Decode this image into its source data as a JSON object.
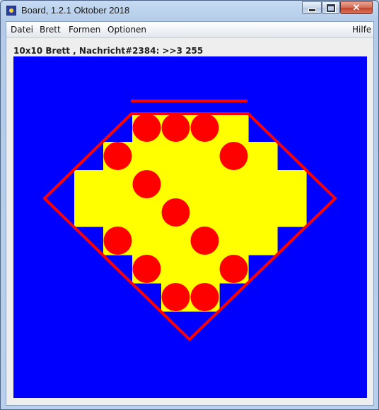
{
  "window": {
    "title": "Board, 1.2.1 Oktober 2018",
    "buttons": {
      "minimize": "minimize-icon",
      "maximize": "maximize-icon",
      "close": "✕"
    }
  },
  "menu": {
    "items": [
      "Datei",
      "Brett",
      "Formen",
      "Optionen"
    ],
    "help": "Hilfe"
  },
  "status": {
    "text": "10x10 Brett , Nachricht#2384: >>3 255"
  },
  "board": {
    "size": 10,
    "colors": {
      "background": "#0000ff",
      "cell": "#ffff00",
      "piece": "#ff0000",
      "outline": "#ff0000"
    },
    "yellow_cells": [
      [
        2,
        0
      ],
      [
        3,
        0
      ],
      [
        4,
        0
      ],
      [
        5,
        0
      ],
      [
        1,
        1
      ],
      [
        2,
        1
      ],
      [
        3,
        1
      ],
      [
        4,
        1
      ],
      [
        5,
        1
      ],
      [
        6,
        1
      ],
      [
        0,
        2
      ],
      [
        1,
        2
      ],
      [
        2,
        2
      ],
      [
        3,
        2
      ],
      [
        4,
        2
      ],
      [
        5,
        2
      ],
      [
        6,
        2
      ],
      [
        7,
        2
      ],
      [
        0,
        3
      ],
      [
        1,
        3
      ],
      [
        2,
        3
      ],
      [
        3,
        3
      ],
      [
        4,
        3
      ],
      [
        5,
        3
      ],
      [
        6,
        3
      ],
      [
        7,
        3
      ],
      [
        1,
        4
      ],
      [
        2,
        4
      ],
      [
        3,
        4
      ],
      [
        4,
        4
      ],
      [
        5,
        4
      ],
      [
        6,
        4
      ],
      [
        2,
        5
      ],
      [
        3,
        5
      ],
      [
        4,
        5
      ],
      [
        5,
        5
      ],
      [
        3,
        6
      ],
      [
        4,
        6
      ]
    ],
    "pieces": [
      [
        2,
        0
      ],
      [
        3,
        0
      ],
      [
        4,
        0
      ],
      [
        1,
        1
      ],
      [
        5,
        1
      ],
      [
        2,
        2
      ],
      [
        3,
        3
      ],
      [
        1,
        4
      ],
      [
        4,
        4
      ],
      [
        2,
        5
      ],
      [
        5,
        5
      ],
      [
        3,
        6
      ],
      [
        4,
        6
      ]
    ]
  }
}
